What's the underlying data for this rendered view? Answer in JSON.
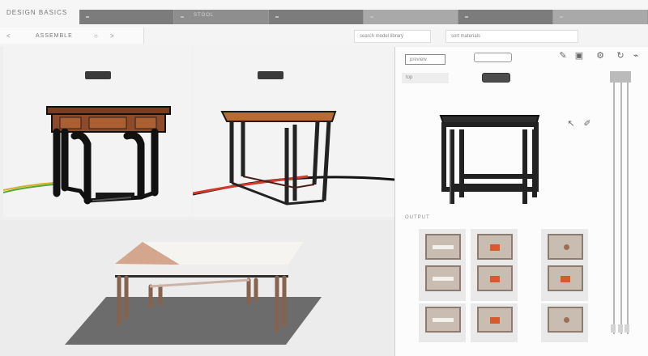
{
  "app": {
    "title": "DESIGN BASICS"
  },
  "tabs": [
    {
      "label": ""
    },
    {
      "label": "STOOL"
    },
    {
      "label": ""
    },
    {
      "label": ""
    },
    {
      "label": ""
    },
    {
      "label": ""
    }
  ],
  "toolbar": {
    "breadcrumb": "ASSEMBLE",
    "nav_left": "<",
    "nav_right": ">",
    "spinner": "○",
    "search_placeholder": "search model library",
    "sort_label": "sort materials"
  },
  "canvas": {
    "viewports": [
      {
        "caption": ""
      },
      {
        "caption": ""
      },
      {
        "caption": ""
      }
    ]
  },
  "panel": {
    "dropdown": "preview",
    "filter_label": "top",
    "header_pill": "",
    "section_label": "OUTPUT",
    "thumbnails": [
      {
        "variant": "white"
      },
      {
        "variant": "red"
      },
      {
        "variant": "knob"
      },
      {
        "variant": "white"
      },
      {
        "variant": "red"
      },
      {
        "variant": "red"
      },
      {
        "variant": "white"
      },
      {
        "variant": "red"
      },
      {
        "variant": "knob"
      }
    ],
    "icons": [
      "edit-icon",
      "image-icon",
      "settings-icon",
      "refresh-icon",
      "wrench-icon"
    ],
    "side_icons": [
      "arrow-icon",
      "pen-icon"
    ]
  },
  "colors": {
    "dark_frame": "#222222",
    "wood_top": "#b86b38",
    "wood_light": "#d1a38b",
    "table_shadow": "#6c6c6c",
    "red_accent": "#d55a2e"
  }
}
